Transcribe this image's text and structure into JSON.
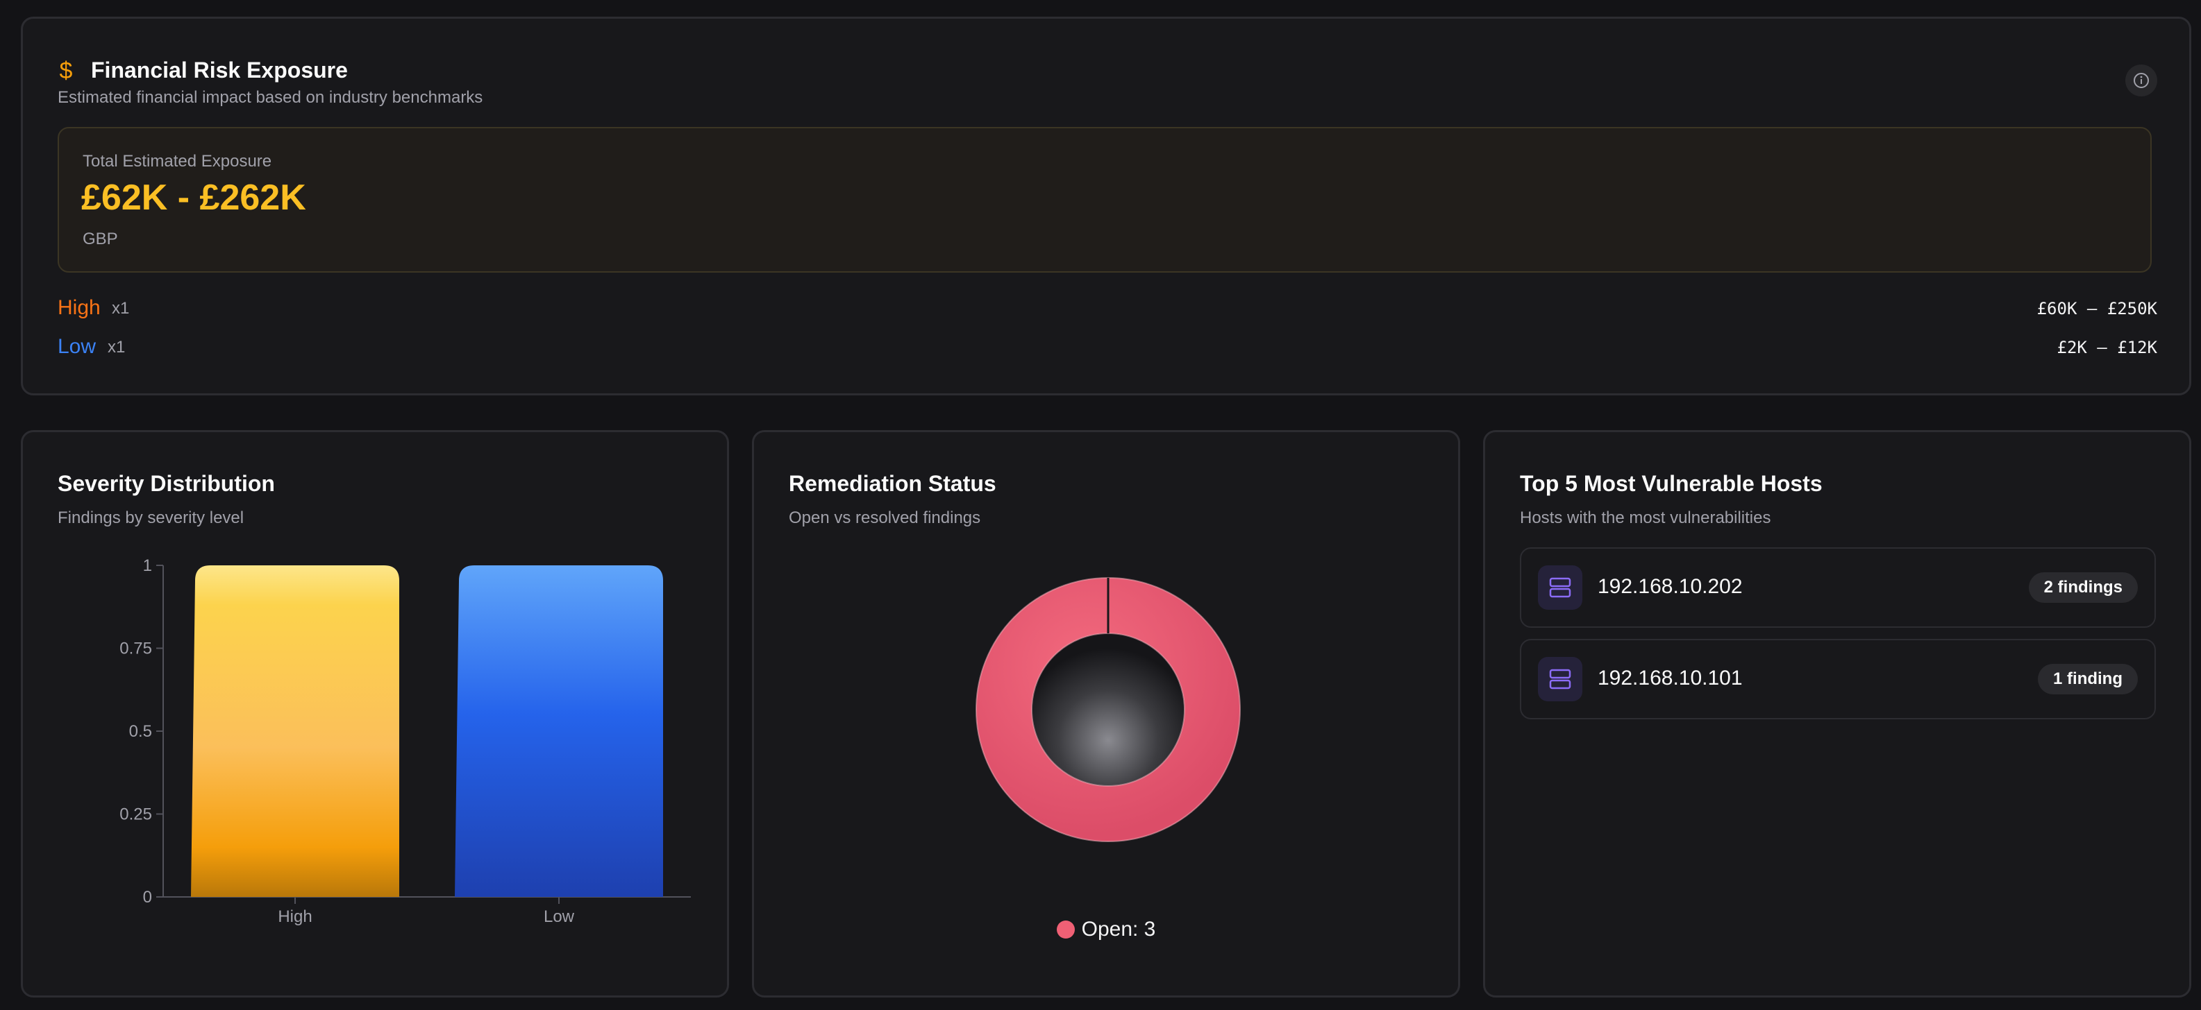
{
  "financial_risk": {
    "title": "Financial Risk Exposure",
    "subtitle": "Estimated financial impact based on industry benchmarks",
    "icon": "dollar-icon",
    "info_icon": "info-icon",
    "total_label": "Total Estimated Exposure",
    "total_value": "£62K - £262K",
    "currency": "GBP",
    "rows": [
      {
        "severity": "High",
        "multiplier": "x1",
        "range": "£60K – £250K",
        "color": "#f97316"
      },
      {
        "severity": "Low",
        "multiplier": "x1",
        "range": "£2K – £12K",
        "color": "#3b82f6"
      }
    ]
  },
  "severity_distribution": {
    "title": "Severity Distribution",
    "subtitle": "Findings by severity level"
  },
  "remediation_status": {
    "title": "Remediation Status",
    "subtitle": "Open vs resolved findings",
    "legend_label": "Open: 3"
  },
  "vulnerable_hosts": {
    "title": "Top 5 Most Vulnerable Hosts",
    "subtitle": "Hosts with the most vulnerabilities",
    "hosts": [
      {
        "ip": "192.168.10.202",
        "badge": "2 findings"
      },
      {
        "ip": "192.168.10.101",
        "badge": "1 finding"
      }
    ]
  },
  "chart_data": [
    {
      "type": "bar",
      "title": "Severity Distribution",
      "categories": [
        "High",
        "Low"
      ],
      "values": [
        1,
        1
      ],
      "colors": [
        "#fbbf24",
        "#3b82f6"
      ],
      "yticks": [
        "0",
        "0.25",
        "0.5",
        "0.75",
        "1"
      ],
      "ylim": [
        0,
        1
      ],
      "grid": false
    },
    {
      "type": "pie",
      "title": "Remediation Status",
      "labels": [
        "Open"
      ],
      "values": [
        3
      ],
      "colors": [
        "#f06075"
      ]
    }
  ]
}
